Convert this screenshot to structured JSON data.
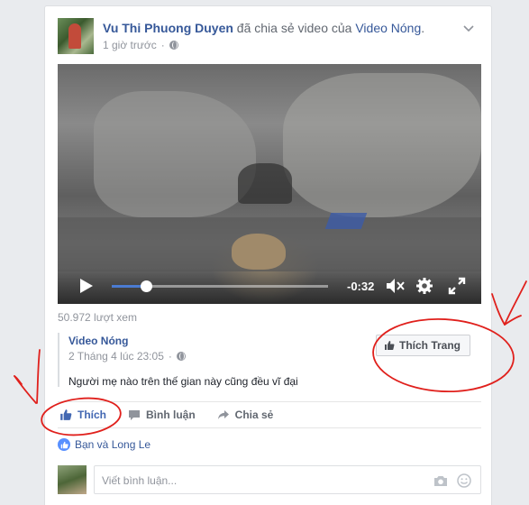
{
  "post": {
    "author": "Vu Thi Phuong Duyen",
    "action_text": " đã chia sẻ video của ",
    "page_link": "Video Nóng",
    "period": ".",
    "time": "1 giờ trước"
  },
  "video": {
    "time_remaining": "-0:32",
    "progress": 0.16
  },
  "view_count": "50.972 lượt xem",
  "shared": {
    "page_name": "Video Nóng",
    "date": "2 Tháng 4 lúc 23:05",
    "separator": "·",
    "text": "Người mẹ nào trên thế gian này cũng đều vĩ đại",
    "like_page_label": "Thích Trang"
  },
  "actions": {
    "like": "Thích",
    "comment": "Bình luận",
    "share": "Chia sẻ"
  },
  "reactions": {
    "text": "Bạn và Long Le"
  },
  "comment": {
    "placeholder": "Viết bình luận..."
  },
  "colors": {
    "link": "#365899",
    "liked": "#4267b2",
    "annotation": "#e0201c",
    "progress": "#4b7bd1"
  }
}
